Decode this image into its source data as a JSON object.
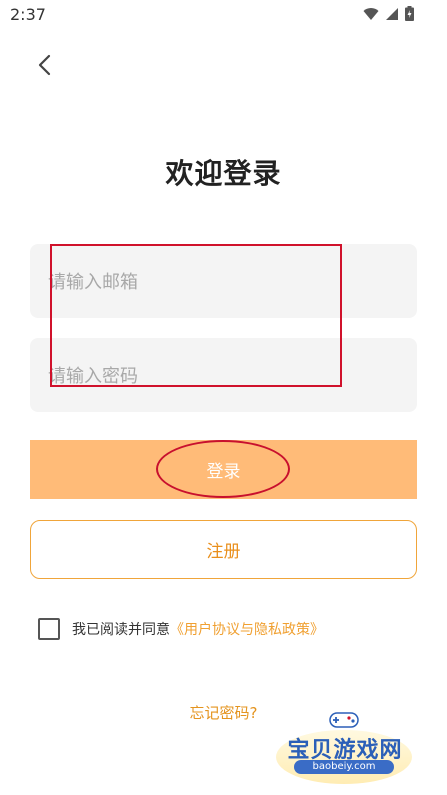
{
  "status_bar": {
    "time": "2:37",
    "icons": [
      "wifi-icon",
      "signal-icon",
      "battery-icon"
    ]
  },
  "header": {
    "back_icon": "back-chevron-icon"
  },
  "title": "欢迎登录",
  "form": {
    "email_placeholder": "请输入邮箱",
    "email_value": "",
    "password_placeholder": "请输入密码",
    "password_value": ""
  },
  "buttons": {
    "login_label": "登录",
    "register_label": "注册"
  },
  "agreement": {
    "checked": false,
    "text": "我已阅读并同意",
    "link_text": "《用户协议与隐私政策》"
  },
  "forgot_password": "忘记密码?",
  "watermark": {
    "site_name": "宝贝游戏网",
    "site_url": "baobeiy.com"
  },
  "colors": {
    "login_button_bg": "#ffbb78",
    "accent_orange": "#f0a031",
    "annotation_red": "#d0112b",
    "field_bg": "#f4f4f4"
  }
}
